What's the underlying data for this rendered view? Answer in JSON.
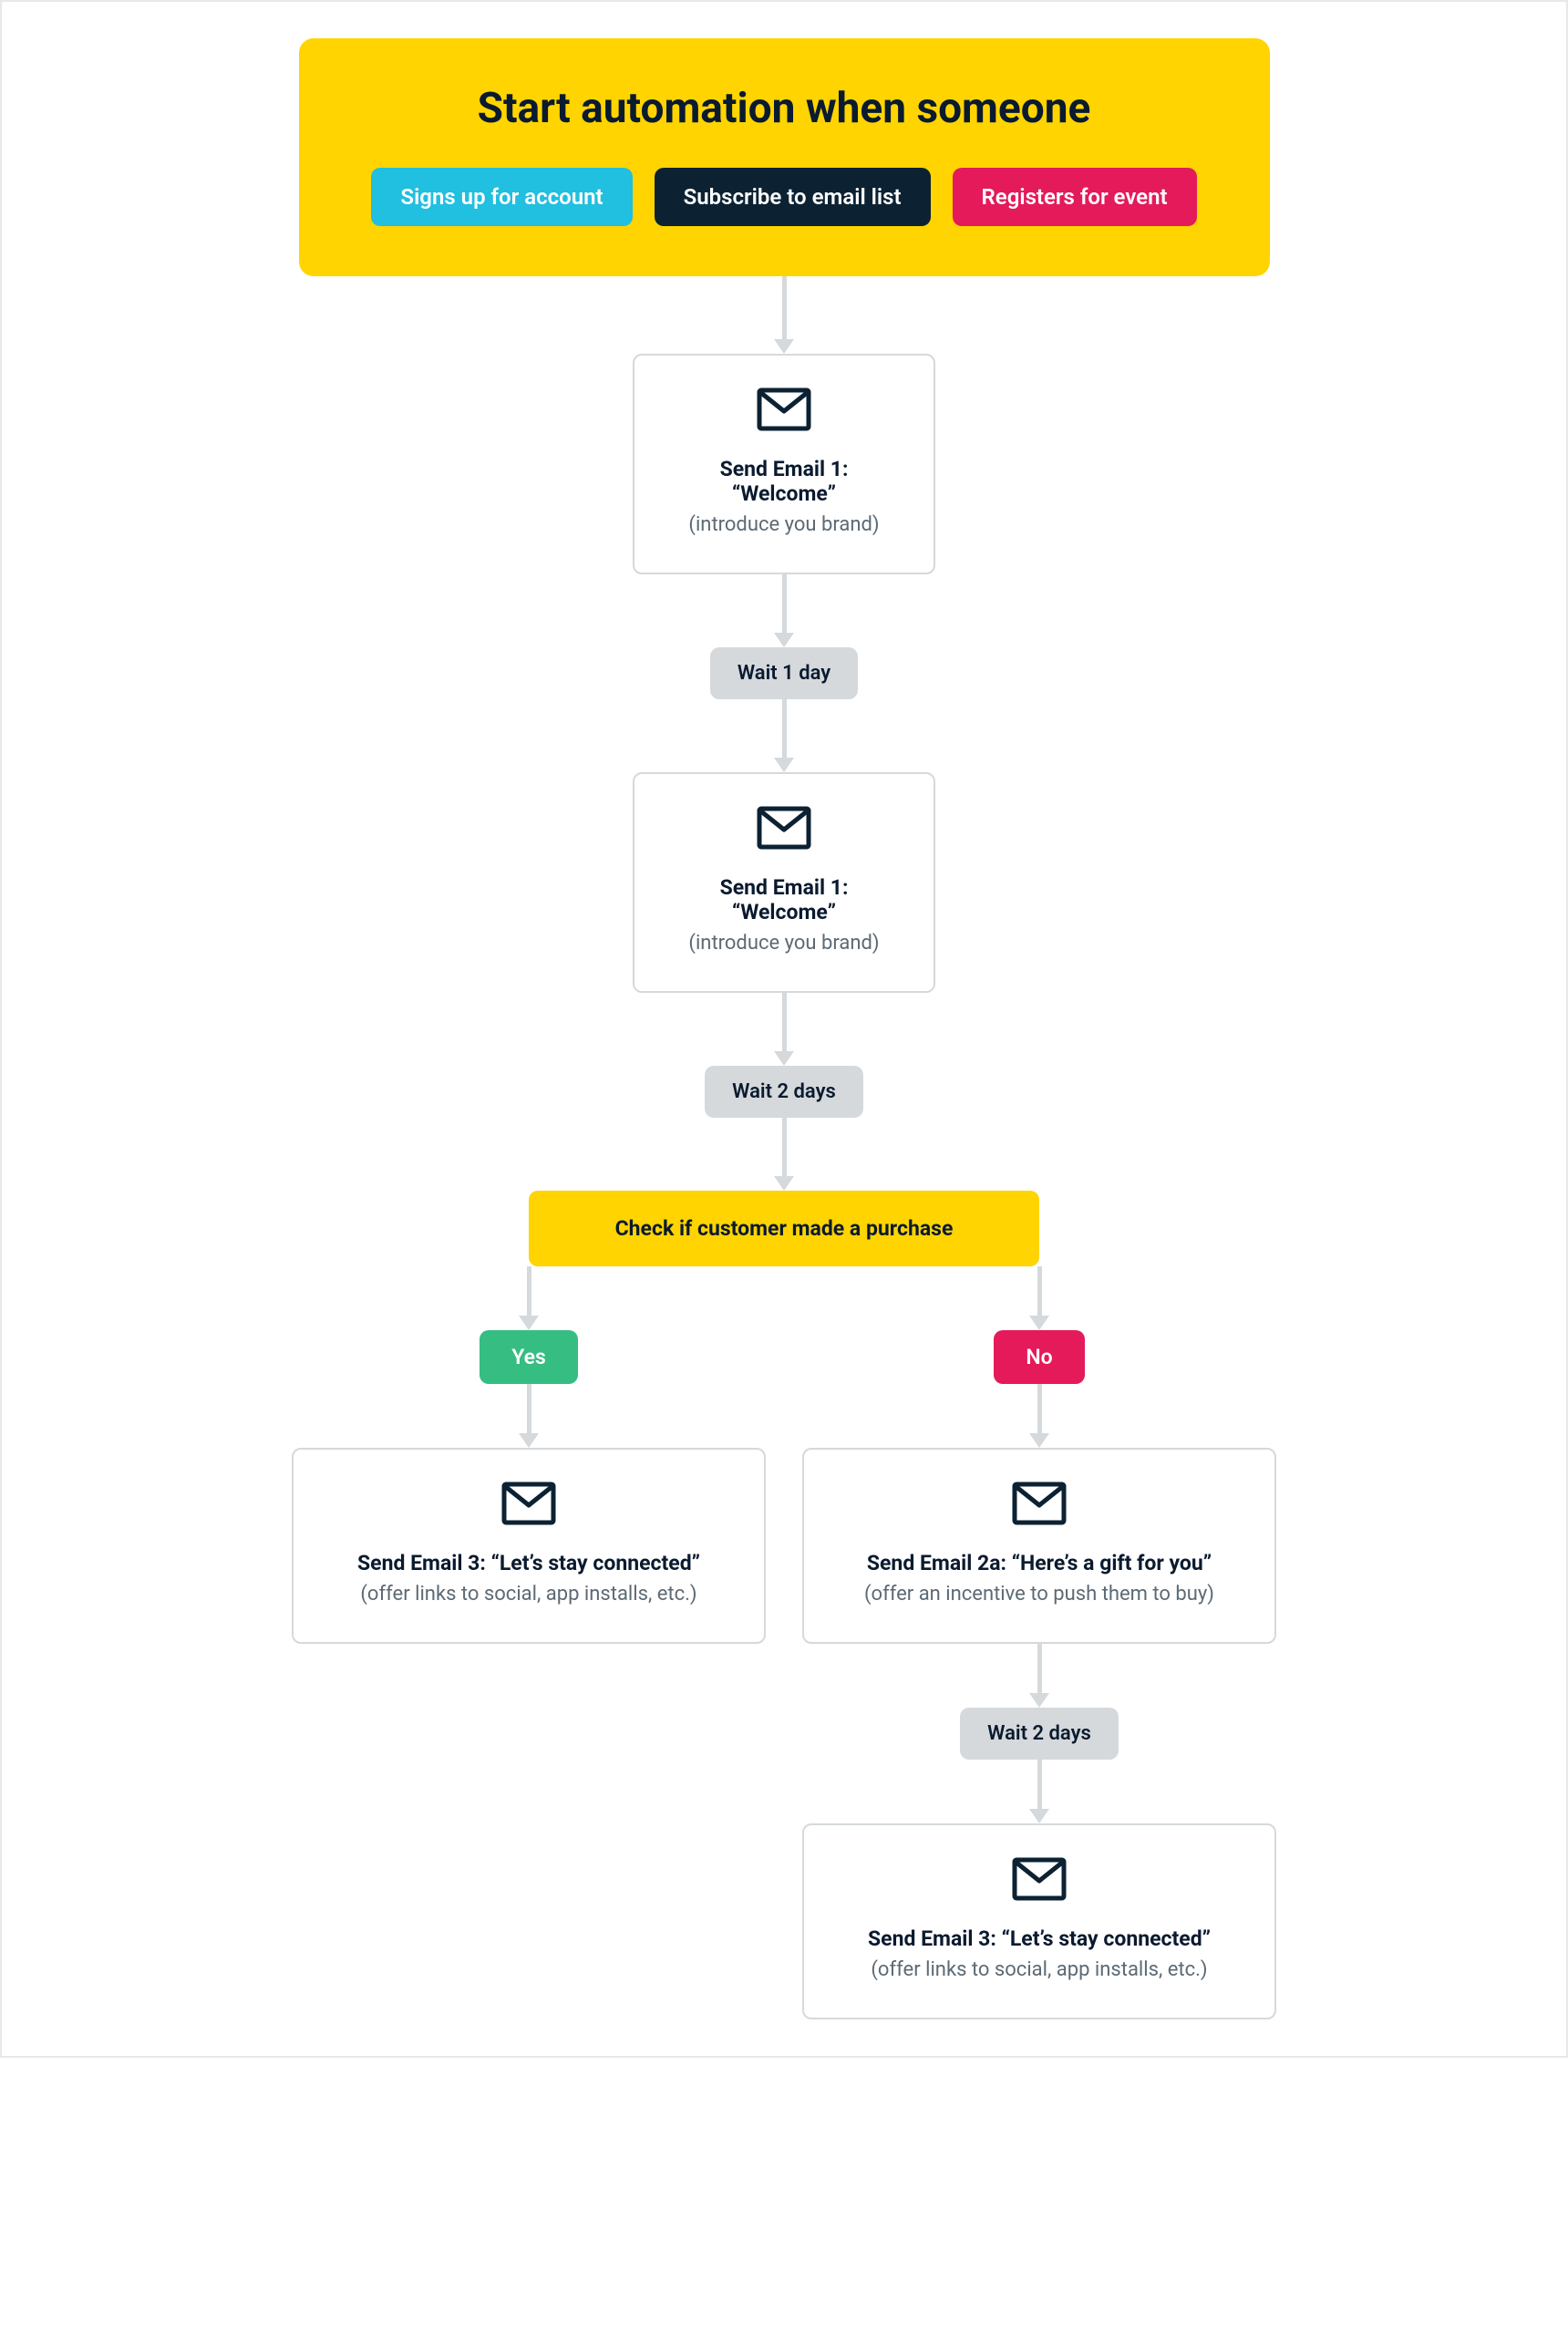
{
  "start": {
    "title": "Start automation when someone",
    "triggers": [
      "Signs up for account",
      "Subscribe to email list",
      "Registers for event"
    ]
  },
  "email1": {
    "title": "Send Email 1: “Welcome”",
    "sub": "(introduce you brand)"
  },
  "wait1": "Wait 1 day",
  "email2": {
    "title": "Send Email 1: “Welcome”",
    "sub": "(introduce you brand)"
  },
  "wait2": "Wait 2 days",
  "decision": "Check if customer made a purchase",
  "yes_label": "Yes",
  "no_label": "No",
  "email_yes": {
    "title": "Send Email 3: “Let’s stay connected”",
    "sub": "(offer links to social, app installs, etc.)"
  },
  "email_no_a": {
    "title": "Send Email 2a: “Here’s a gift for you”",
    "sub": "(offer an incentive to push them to buy)"
  },
  "wait3": "Wait 2 days",
  "email_no_b": {
    "title": "Send Email 3: “Let’s stay connected”",
    "sub": "(offer links to social, app installs, etc.)"
  }
}
